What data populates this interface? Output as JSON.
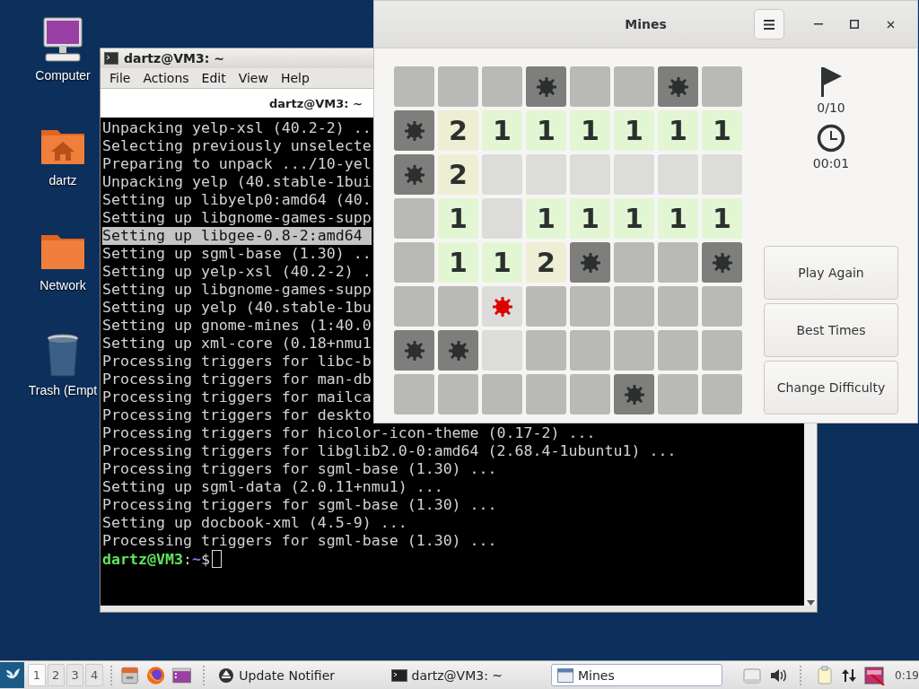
{
  "desktop": {
    "icons": [
      {
        "kind": "computer",
        "label": "Computer"
      },
      {
        "kind": "home",
        "label": "dartz"
      },
      {
        "kind": "folder",
        "label": "Network"
      },
      {
        "kind": "trash",
        "label": "Trash (Empt"
      }
    ]
  },
  "terminal": {
    "title": "dartz@VM3: ~",
    "menu": [
      "File",
      "Actions",
      "Edit",
      "View",
      "Help"
    ],
    "tab": "dartz@VM3: ~",
    "lines": [
      {
        "text": "Unpacking yelp-xsl (40.2-2) ..",
        "selected": false
      },
      {
        "text": "Selecting previously unselecte",
        "selected": false
      },
      {
        "text": "Preparing to unpack .../10-yel",
        "selected": false
      },
      {
        "text": "Unpacking yelp (40.stable-1bui",
        "selected": false
      },
      {
        "text": "Setting up libyelp0:amd64 (40.",
        "selected": false
      },
      {
        "text": "Setting up libgnome-games-supp",
        "selected": false
      },
      {
        "text": "Setting up libgee-0.8-2:amd64",
        "selected": true
      },
      {
        "text": "Setting up sgml-base (1.30) ..",
        "selected": false
      },
      {
        "text": "Setting up yelp-xsl (40.2-2) .",
        "selected": false
      },
      {
        "text": "Setting up libgnome-games-supp",
        "selected": false
      },
      {
        "text": "Setting up yelp (40.stable-1bu",
        "selected": false
      },
      {
        "text": "Setting up gnome-mines (1:40.0",
        "selected": false
      },
      {
        "text": "Setting up xml-core (0.18+nmu1",
        "selected": false
      },
      {
        "text": "Processing triggers for libc-b",
        "selected": false
      },
      {
        "text": "Processing triggers for man-db",
        "selected": false
      },
      {
        "text": "Processing triggers for mailca",
        "selected": false
      },
      {
        "text": "Processing triggers for deskto",
        "selected": false
      },
      {
        "text": "Processing triggers for hicolor-icon-theme (0.17-2) ...",
        "selected": false
      },
      {
        "text": "Processing triggers for libglib2.0-0:amd64 (2.68.4-1ubuntu1) ...",
        "selected": false
      },
      {
        "text": "Processing triggers for sgml-base (1.30) ...",
        "selected": false
      },
      {
        "text": "Setting up sgml-data (2.0.11+nmu1) ...",
        "selected": false
      },
      {
        "text": "Processing triggers for sgml-base (1.30) ...",
        "selected": false
      },
      {
        "text": "Setting up docbook-xml (4.5-9) ...",
        "selected": false
      },
      {
        "text": "Processing triggers for sgml-base (1.30) ...",
        "selected": false
      }
    ],
    "prompt": {
      "user": "dartz@VM3",
      "separator": ":",
      "path": "~",
      "symbol": "$"
    }
  },
  "mines": {
    "title": "Mines",
    "board": [
      [
        {
          "kind": "hidden"
        },
        {
          "kind": "hidden"
        },
        {
          "kind": "hidden"
        },
        {
          "kind": "mine"
        },
        {
          "kind": "hidden"
        },
        {
          "kind": "hidden"
        },
        {
          "kind": "mine"
        },
        {
          "kind": "hidden"
        }
      ],
      [
        {
          "kind": "mine"
        },
        {
          "kind": "number",
          "text": "2",
          "color": "#eeeed4"
        },
        {
          "kind": "number",
          "text": "1",
          "color": "#e2f6d4"
        },
        {
          "kind": "number",
          "text": "1",
          "color": "#e2f6d4"
        },
        {
          "kind": "number",
          "text": "1",
          "color": "#e2f6d4"
        },
        {
          "kind": "number",
          "text": "1",
          "color": "#e2f6d4"
        },
        {
          "kind": "number",
          "text": "1",
          "color": "#e2f6d4"
        },
        {
          "kind": "number",
          "text": "1",
          "color": "#e2f6d4"
        }
      ],
      [
        {
          "kind": "mine"
        },
        {
          "kind": "number",
          "text": "2",
          "color": "#eeeed4"
        },
        {
          "kind": "empty"
        },
        {
          "kind": "empty"
        },
        {
          "kind": "empty"
        },
        {
          "kind": "empty"
        },
        {
          "kind": "empty"
        },
        {
          "kind": "empty"
        }
      ],
      [
        {
          "kind": "hidden"
        },
        {
          "kind": "number",
          "text": "1",
          "color": "#e2f6d4"
        },
        {
          "kind": "empty"
        },
        {
          "kind": "number",
          "text": "1",
          "color": "#e2f6d4"
        },
        {
          "kind": "number",
          "text": "1",
          "color": "#e2f6d4"
        },
        {
          "kind": "number",
          "text": "1",
          "color": "#e2f6d4"
        },
        {
          "kind": "number",
          "text": "1",
          "color": "#e2f6d4"
        },
        {
          "kind": "number",
          "text": "1",
          "color": "#e2f6d4"
        }
      ],
      [
        {
          "kind": "hidden"
        },
        {
          "kind": "number",
          "text": "1",
          "color": "#e2f6d4"
        },
        {
          "kind": "number",
          "text": "1",
          "color": "#e2f6d4"
        },
        {
          "kind": "number",
          "text": "2",
          "color": "#eeeed4"
        },
        {
          "kind": "mine"
        },
        {
          "kind": "hidden"
        },
        {
          "kind": "hidden"
        },
        {
          "kind": "mine"
        }
      ],
      [
        {
          "kind": "hidden"
        },
        {
          "kind": "hidden"
        },
        {
          "kind": "exploded"
        },
        {
          "kind": "hidden"
        },
        {
          "kind": "hidden"
        },
        {
          "kind": "hidden"
        },
        {
          "kind": "hidden"
        },
        {
          "kind": "hidden"
        }
      ],
      [
        {
          "kind": "mine"
        },
        {
          "kind": "mine"
        },
        {
          "kind": "empty"
        },
        {
          "kind": "hidden"
        },
        {
          "kind": "hidden"
        },
        {
          "kind": "hidden"
        },
        {
          "kind": "hidden"
        },
        {
          "kind": "hidden"
        }
      ],
      [
        {
          "kind": "hidden"
        },
        {
          "kind": "hidden"
        },
        {
          "kind": "hidden"
        },
        {
          "kind": "hidden"
        },
        {
          "kind": "hidden"
        },
        {
          "kind": "mine"
        },
        {
          "kind": "hidden"
        },
        {
          "kind": "hidden"
        }
      ]
    ],
    "flags": "0/10",
    "time": "00:01",
    "buttons": [
      "Play Again",
      "Best Times",
      "Change Difficulty"
    ]
  },
  "taskbar": {
    "workspaces": [
      {
        "label": "1",
        "selected": true
      },
      {
        "label": "2",
        "selected": false
      },
      {
        "label": "3",
        "selected": false
      },
      {
        "label": "4",
        "selected": false
      }
    ],
    "tasks": [
      {
        "kind": "update",
        "label": "Update Notifier",
        "selected": false
      },
      {
        "kind": "terminal",
        "label": "dartz@VM3: ~",
        "selected": false
      },
      {
        "kind": "window",
        "label": "Mines",
        "selected": true
      }
    ],
    "clock": "0:19"
  }
}
